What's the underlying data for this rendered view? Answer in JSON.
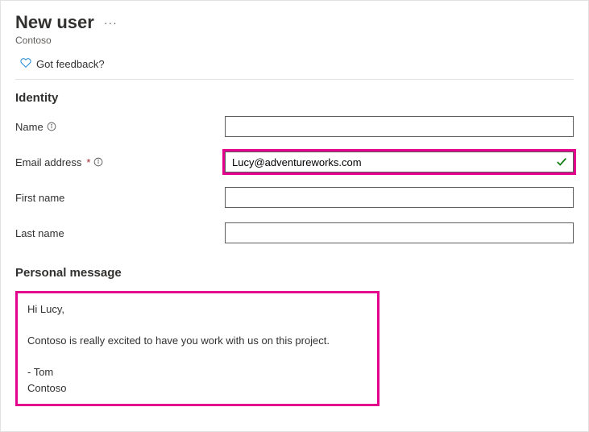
{
  "header": {
    "title": "New user",
    "more_actions": "···",
    "subtitle": "Contoso"
  },
  "feedback": {
    "label": "Got feedback?"
  },
  "identity": {
    "section_title": "Identity",
    "fields": {
      "name": {
        "label": "Name",
        "value": "",
        "required": false
      },
      "email": {
        "label": "Email address",
        "value": "Lucy@adventureworks.com",
        "required": true,
        "validated": true
      },
      "first_name": {
        "label": "First name",
        "value": "",
        "required": false
      },
      "last_name": {
        "label": "Last name",
        "value": "",
        "required": false
      }
    }
  },
  "personal_message": {
    "section_title": "Personal message",
    "body": "Hi Lucy,\n\nContoso is really excited to have you work with us on this project.\n\n- Tom\nContoso"
  }
}
